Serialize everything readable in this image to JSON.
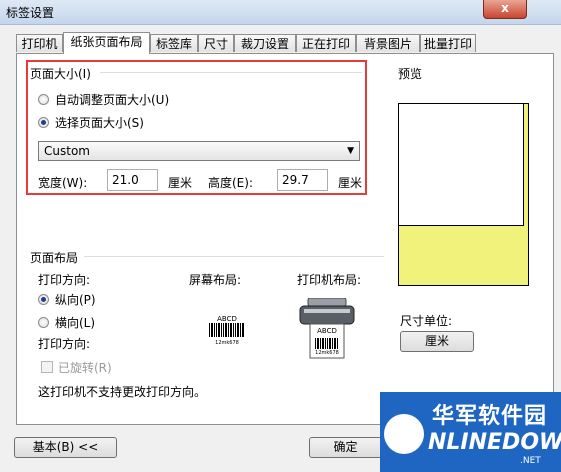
{
  "window": {
    "title": "标签设置",
    "close_glyph": "x"
  },
  "tabs": [
    {
      "label": "打印机"
    },
    {
      "label": "纸张页面布局"
    },
    {
      "label": "标签库"
    },
    {
      "label": "尺寸"
    },
    {
      "label": "裁刀设置"
    },
    {
      "label": "正在打印"
    },
    {
      "label": "背景图片"
    },
    {
      "label": "批量打印"
    }
  ],
  "page_size": {
    "group_label": "页面大小(I)",
    "auto_radio": "自动调整页面大小(U)",
    "select_radio": "选择页面大小(S)",
    "size_select_value": "Custom",
    "width_label": "宽度(W):",
    "width_value": "21.0",
    "width_unit": "厘米",
    "height_label": "高度(E):",
    "height_value": "29.7",
    "height_unit": "厘米"
  },
  "layout": {
    "group_label": "页面布局",
    "print_direction_label": "打印方向:",
    "portrait": "纵向(P)",
    "landscape": "横向(L)",
    "print_direction_label2": "打印方向:",
    "rotated": "已旋转(R)",
    "screen_layout_label": "屏幕布局:",
    "printer_layout_label": "打印机布局:",
    "barcode_text": "ABCD",
    "barcode_digits": "12mk678",
    "printer_barcode_text": "ABCD",
    "printer_barcode_digits": "12mk678",
    "note": "这打印机不支持更改打印方向。"
  },
  "preview": {
    "label": "预览",
    "unit_label": "尺寸单位:",
    "unit_button": "厘米"
  },
  "buttons": {
    "basic": "基本(B) <<",
    "ok": "确定"
  },
  "watermark": {
    "cn": "华军软件园",
    "en": "NLINEDOWN",
    "net": ".NET"
  }
}
